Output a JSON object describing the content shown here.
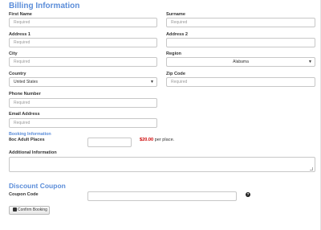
{
  "billing": {
    "title": "Billing Information",
    "first_name": {
      "label": "First Name",
      "placeholder": "Required"
    },
    "surname": {
      "label": "Surname",
      "placeholder": "Required"
    },
    "address1": {
      "label": "Address 1",
      "placeholder": "Required"
    },
    "address2": {
      "label": "Address 2",
      "placeholder": ""
    },
    "city": {
      "label": "City",
      "placeholder": "Required"
    },
    "region": {
      "label": "Region",
      "value": "Alabama"
    },
    "country": {
      "label": "Country",
      "value": "United States"
    },
    "zip": {
      "label": "Zip Code",
      "placeholder": "Required"
    },
    "phone": {
      "label": "Phone Number",
      "placeholder": "Required"
    },
    "email": {
      "label": "Email Address",
      "placeholder": "Required"
    }
  },
  "booking": {
    "title": "Booking Information",
    "places_label": "8oc Adult Places",
    "places_value": "",
    "price_amount": "$20.00",
    "price_suffix": " per place.",
    "additional_label": "Additional Information"
  },
  "coupon": {
    "title": "Discount Coupon",
    "code_label": "Coupon Code",
    "code_value": "",
    "help_glyph": "?"
  },
  "actions": {
    "confirm_label": "Confirm Booking",
    "confirm_icon": "checkbox-icon"
  }
}
